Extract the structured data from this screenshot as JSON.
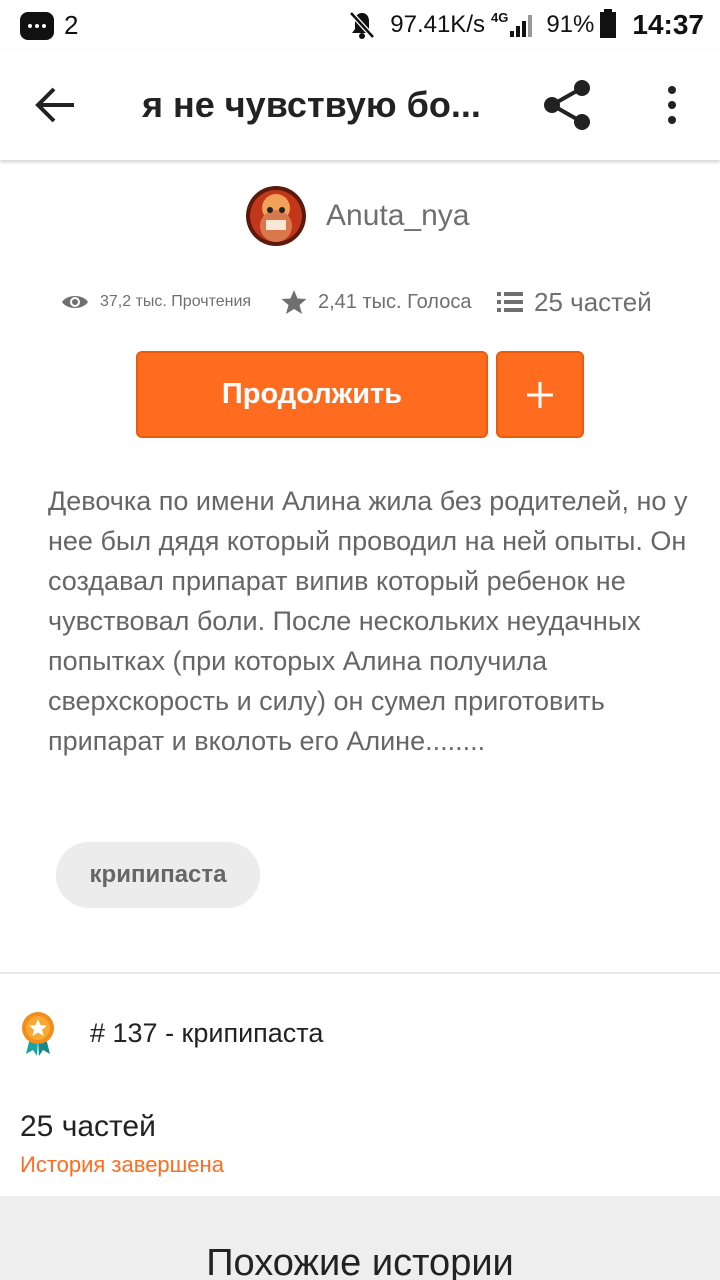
{
  "status_bar": {
    "notification_count": "2",
    "speed": "97.41K/s",
    "network": "4G",
    "battery": "91%",
    "time": "14:37"
  },
  "toolbar": {
    "title": "я не чувствую бо..."
  },
  "author": {
    "name": "Anuta_nya"
  },
  "stats": {
    "reads": "37,2 тыс. Прочтения",
    "votes": "2,41 тыс. Голоса",
    "parts": "25 частей"
  },
  "actions": {
    "continue_label": "Продолжить"
  },
  "description": "Девочка по имени Алина жила без родителей, но у нее был дядя который проводил на ней опыты. Он создавал припарат випив который ребенок не чувствовал боли. После нескольких неудачных попытках (при которых Алина получила сверхскорость и силу) он сумел приготовить припарат и вколоть его Алине........",
  "tag": "крипипаста",
  "rank": "# 137 - крипипаста",
  "parts_count": "25 частей",
  "completion_status": "История завершена",
  "similar_title": "Похожие истории",
  "colors": {
    "accent": "#ff6c1f",
    "text": "#222222",
    "secondary_text": "#6f6f6f"
  }
}
